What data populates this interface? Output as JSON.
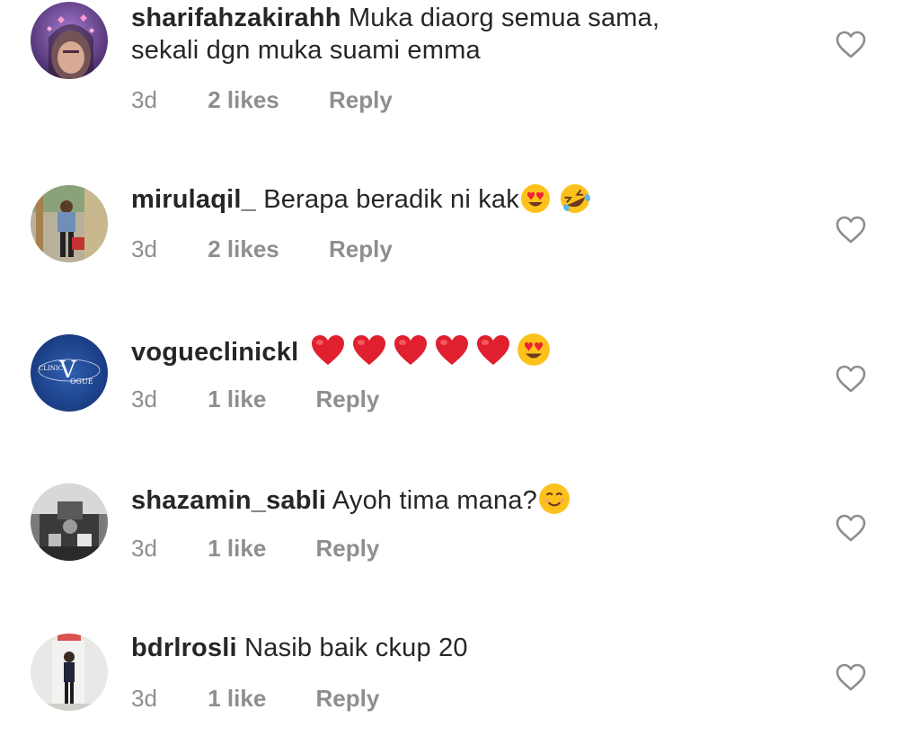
{
  "comments": [
    {
      "username": "sharifahzakirahh",
      "text_line1": "Muka diaorg semua sama,",
      "text_line2": "sekali dgn muka suami emma",
      "time": "3d",
      "likes": "2 likes",
      "reply": "Reply"
    },
    {
      "username": "mirulaqil_",
      "text_line1": "Berapa beradik ni kak",
      "time": "3d",
      "likes": "2 likes",
      "reply": "Reply"
    },
    {
      "username": "vogueclinickl",
      "text_line1": "",
      "avatar_text_1": "CLINIC",
      "avatar_text_2": "V",
      "avatar_text_3": "OGUE",
      "time": "3d",
      "likes": "1 like",
      "reply": "Reply"
    },
    {
      "username": "shazamin_sabli",
      "text_line1": "Ayoh tima mana?",
      "time": "3d",
      "likes": "1 like",
      "reply": "Reply"
    },
    {
      "username": "bdrlrosli",
      "text_line1": "Nasib baik ckup 20",
      "time": "3d",
      "likes": "1 like",
      "reply": "Reply"
    }
  ],
  "colors": {
    "text": "#262626",
    "secondary": "#8e8e8e",
    "heart_red": "#ed2233",
    "emoji_yellow": "#fcc21b"
  }
}
